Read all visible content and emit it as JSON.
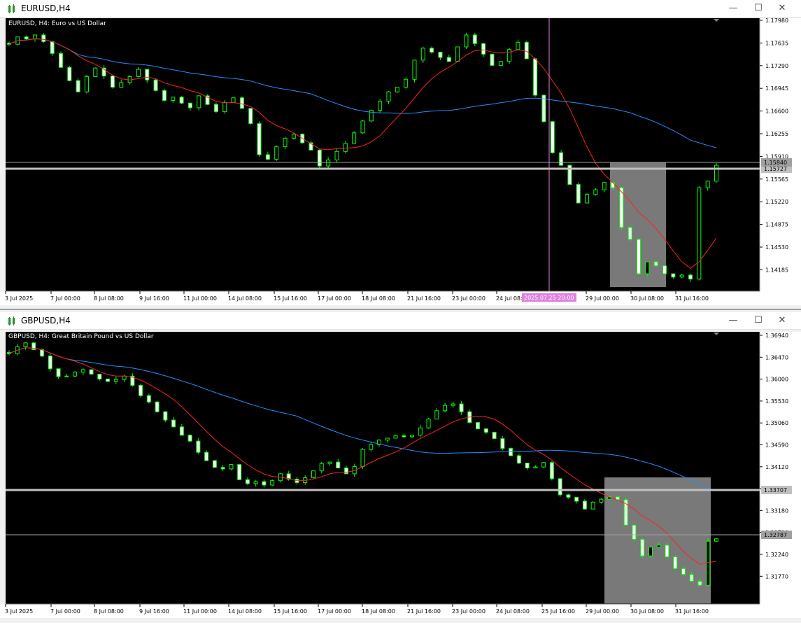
{
  "windows": [
    {
      "title": "EURUSD,H4",
      "chart_title": "EURUSD, H4:  Euro vs US Dollar",
      "price_ticks": [
        "1.17980",
        "1.17635",
        "1.17290",
        "1.16945",
        "1.16600",
        "1.16255",
        "1.15910",
        "1.15565",
        "1.15220",
        "1.14875",
        "1.14530",
        "1.14185"
      ],
      "time_ticks": [
        "3 Jul 2025",
        "7 Jul 00:00",
        "8 Jul 08:00",
        "9 Jul 16:00",
        "11 Jul 00:00",
        "14 Jul 08:00",
        "15 Jul 16:00",
        "17 Jul 00:00",
        "18 Jul 08:00",
        "21 Jul 16:00",
        "23 Jul 00:00",
        "24 Jul 08:00",
        "29 Jul 00:00",
        "30 Jul 08:00",
        "31 Jul 16:00"
      ],
      "crosshair_time": "2025.07.25 20:00",
      "bid_label": "1.15840",
      "hline_label": "1.15727"
    },
    {
      "title": "GBPUSD,H4",
      "chart_title": "GBPUSD, H4:  Great Britain Pound vs US Dollar",
      "price_ticks": [
        "1.36940",
        "1.36470",
        "1.36000",
        "1.35530",
        "1.35060",
        "1.34590",
        "1.34120",
        "1.33650",
        "1.33180",
        "1.32710",
        "1.32240",
        "1.31770"
      ],
      "time_ticks": [
        "3 Jul 2025",
        "7 Jul 00:00",
        "8 Jul 08:00",
        "9 Jul 16:00",
        "11 Jul 00:00",
        "14 Jul 08:00",
        "15 Jul 16:00",
        "17 Jul 00:00",
        "18 Jul 08:00",
        "21 Jul 16:00",
        "23 Jul 00:00",
        "24 Jul 08:00",
        "25 Jul 16:00",
        "29 Jul 00:00",
        "30 Jul 08:00",
        "31 Jul 16:00"
      ],
      "bid_label": "1.32787",
      "hline_label": "1.33707"
    }
  ],
  "window_controls": {
    "minimize": "—",
    "maximize": "☐",
    "close": "✕"
  },
  "colors": {
    "bull": "#00ff00",
    "bear": "#ffffff",
    "ma_fast": "#ff2020",
    "ma_slow": "#1e90ff",
    "crosshair": "#e080e0",
    "zone": "#808080"
  },
  "chart_data": [
    {
      "type": "candlestick",
      "title": "EURUSD, H4:  Euro vs US Dollar",
      "ylim": [
        1.14,
        1.18
      ],
      "close_path": [
        1.1767,
        1.1778,
        1.1775,
        1.1781,
        1.1771,
        1.1753,
        1.1732,
        1.1712,
        1.1695,
        1.1718,
        1.1731,
        1.1719,
        1.1702,
        1.1709,
        1.1718,
        1.1729,
        1.1713,
        1.1697,
        1.1682,
        1.1687,
        1.1678,
        1.1671,
        1.1689,
        1.1676,
        1.1665,
        1.1679,
        1.1686,
        1.167,
        1.1647,
        1.16,
        1.1593,
        1.1612,
        1.1625,
        1.1631,
        1.1618,
        1.1607,
        1.1583,
        1.1592,
        1.1605,
        1.1617,
        1.1633,
        1.1651,
        1.1667,
        1.1681,
        1.1695,
        1.1702,
        1.1714,
        1.1743,
        1.1761,
        1.1755,
        1.1747,
        1.1741,
        1.1763,
        1.1781,
        1.1768,
        1.1752,
        1.1735,
        1.1741,
        1.1759,
        1.177,
        1.1745,
        1.169,
        1.165,
        1.1603,
        1.1584,
        1.1555,
        1.1527,
        1.154,
        1.1547,
        1.1558,
        1.155,
        1.149,
        1.1472,
        1.142,
        1.1438,
        1.1432,
        1.142,
        1.1415,
        1.1418,
        1.1412,
        1.155,
        1.156,
        1.1584
      ]
    },
    {
      "type": "candlestick",
      "title": "GBPUSD, H4:  Great Britain Pound vs US Dollar",
      "ylim": [
        1.316,
        1.37
      ],
      "close_path": [
        1.3664,
        1.3678,
        1.3686,
        1.3672,
        1.3659,
        1.3633,
        1.3617,
        1.3618,
        1.3626,
        1.3631,
        1.3622,
        1.3612,
        1.3607,
        1.3611,
        1.3618,
        1.3599,
        1.3578,
        1.3565,
        1.3545,
        1.3528,
        1.3514,
        1.3497,
        1.3485,
        1.3462,
        1.3445,
        1.3431,
        1.3428,
        1.3437,
        1.3406,
        1.3398,
        1.3402,
        1.3395,
        1.3404,
        1.3418,
        1.3407,
        1.34,
        1.341,
        1.3424,
        1.3439,
        1.3442,
        1.343,
        1.3418,
        1.3433,
        1.3468,
        1.3478,
        1.3487,
        1.3491,
        1.3496,
        1.3494,
        1.3497,
        1.3512,
        1.353,
        1.3547,
        1.3558,
        1.3561,
        1.3545,
        1.3523,
        1.351,
        1.3503,
        1.349,
        1.347,
        1.3455,
        1.344,
        1.343,
        1.3432,
        1.3441,
        1.3408,
        1.3375,
        1.337,
        1.3362,
        1.3346,
        1.336,
        1.3366,
        1.3371,
        1.3365,
        1.3313,
        1.3284,
        1.325,
        1.3268,
        1.3272,
        1.3248,
        1.3224,
        1.3212,
        1.3198,
        1.319,
        1.328,
        1.3285
      ]
    }
  ]
}
